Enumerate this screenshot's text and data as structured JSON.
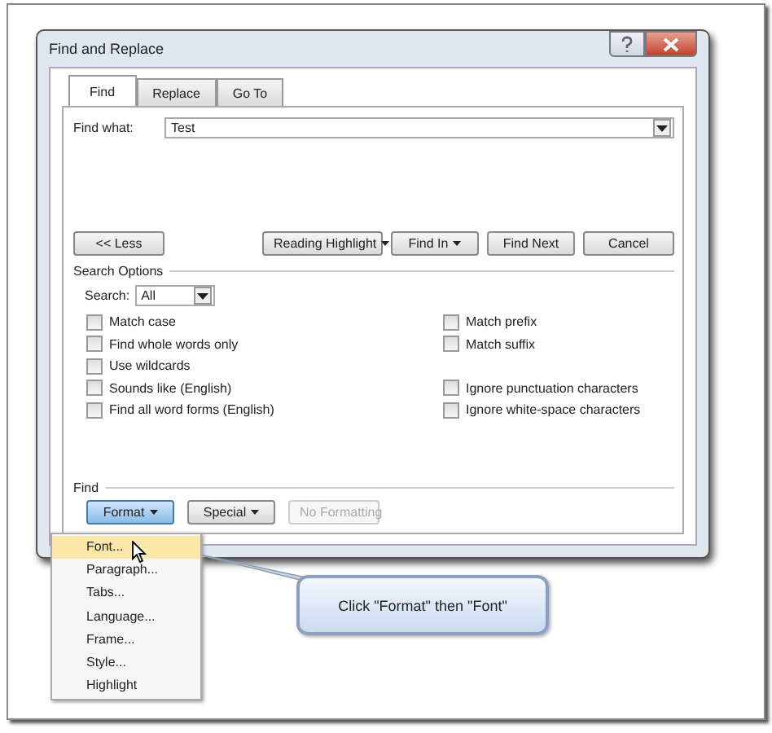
{
  "window": {
    "title": "Find and Replace"
  },
  "tabs": [
    {
      "label": "Find",
      "selected": true
    },
    {
      "label": "Replace",
      "selected": false
    },
    {
      "label": "Go To",
      "selected": false
    }
  ],
  "find_what": {
    "label": "Find what:",
    "value": "Test"
  },
  "buttons": [
    {
      "label": "<< Less",
      "kind": "plain"
    },
    {
      "label": "Reading Highlight",
      "kind": "menu"
    },
    {
      "label": "Find In",
      "kind": "menu"
    },
    {
      "label": "Find Next",
      "kind": "plain"
    },
    {
      "label": "Cancel",
      "kind": "plain"
    }
  ],
  "search_options": {
    "title": "Search Options",
    "search": {
      "label": "Search:",
      "value": "All"
    },
    "rows": [
      {
        "left": {
          "label": "Match case",
          "checked": false
        },
        "right": {
          "label": "Match prefix",
          "checked": false
        }
      },
      {
        "left": {
          "label": "Find whole words only",
          "checked": false
        },
        "right": {
          "label": "Match suffix",
          "checked": false
        }
      },
      {
        "left": {
          "label": "Use wildcards",
          "checked": false
        }
      },
      {
        "left": {
          "label": "Sounds like (English)",
          "checked": false
        },
        "right": {
          "label": "Ignore punctuation characters",
          "checked": false
        }
      },
      {
        "left": {
          "label": "Find all word forms (English)",
          "checked": false
        },
        "right": {
          "label": "Ignore white-space characters",
          "checked": false
        }
      }
    ]
  },
  "find_section": {
    "title": "Find",
    "buttons": [
      {
        "label": "Format",
        "kind": "menu",
        "selected": true,
        "disabled": false
      },
      {
        "label": "Special",
        "kind": "menu",
        "selected": false,
        "disabled": false
      },
      {
        "label": "No Formatting",
        "kind": "plain",
        "selected": false,
        "disabled": true
      }
    ]
  },
  "format_menu": [
    {
      "label": "Font...",
      "selected": true
    },
    {
      "label": "Paragraph...",
      "selected": false
    },
    {
      "label": "Tabs...",
      "selected": false
    },
    {
      "label": "Language...",
      "selected": false
    },
    {
      "label": "Frame...",
      "selected": false
    },
    {
      "label": "Style...",
      "selected": false
    },
    {
      "label": "Highlight",
      "selected": false
    }
  ],
  "callout": {
    "text": "Click \"Format\" then \"Font\""
  }
}
